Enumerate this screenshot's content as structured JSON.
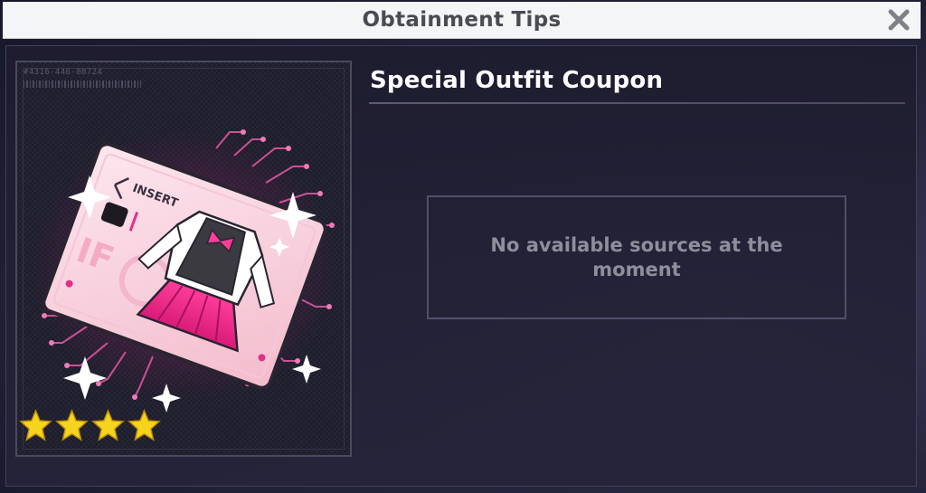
{
  "dialog": {
    "title": "Obtainment Tips",
    "close_icon": "close-icon"
  },
  "item": {
    "serial_code": "#4316-446-00724",
    "name": "Special Outfit Coupon",
    "coupon_text": "INSERT",
    "rarity_stars": 4,
    "star_color": "#f5d31e",
    "accent_color": "#e0308a"
  },
  "sources": {
    "empty_message": "No available sources at the moment"
  }
}
